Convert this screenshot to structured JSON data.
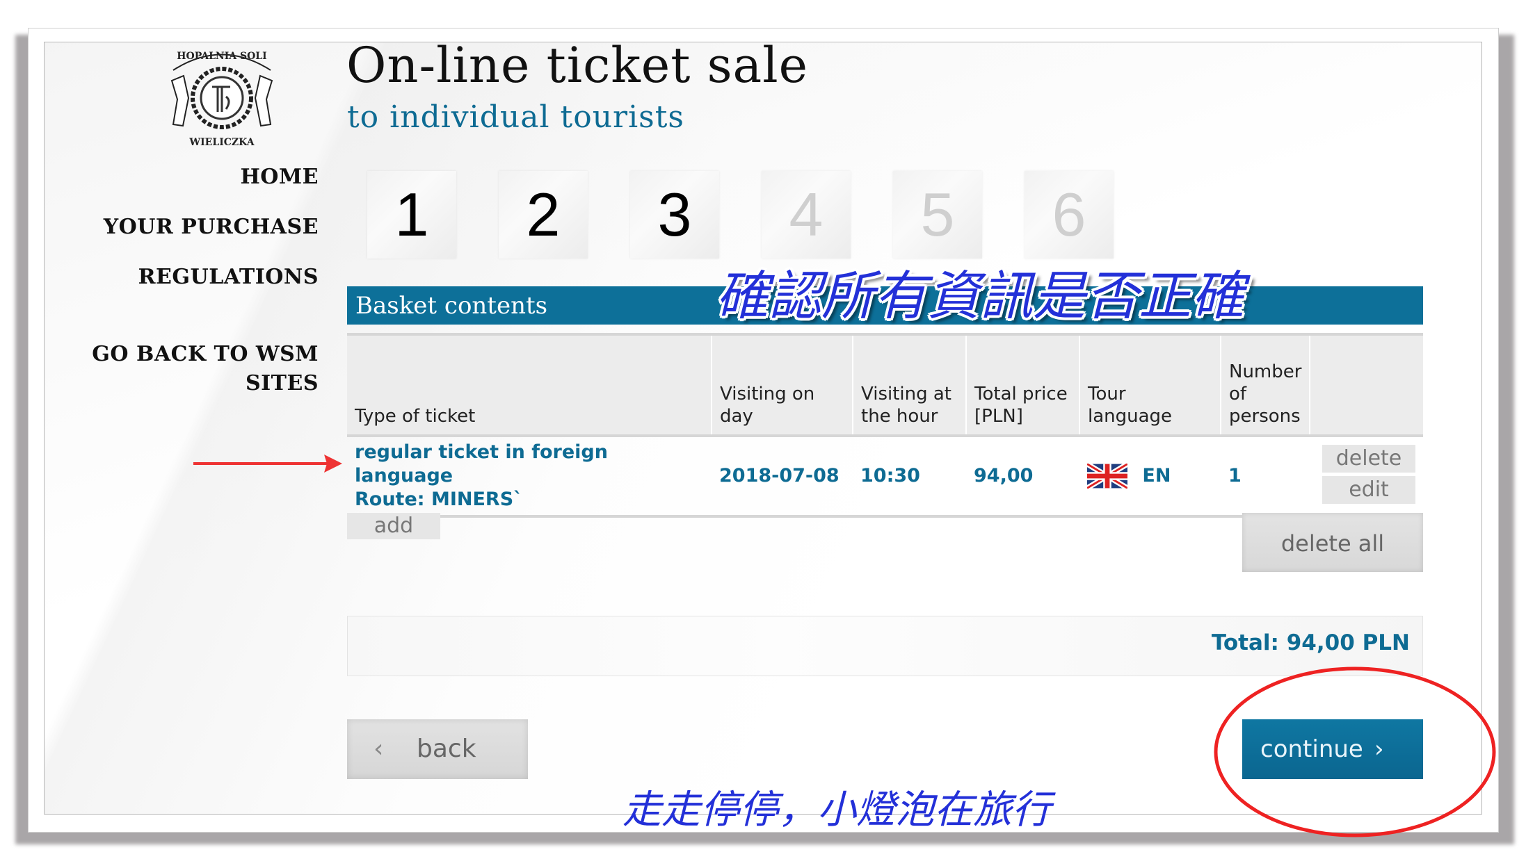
{
  "header": {
    "title": "On-line ticket sale",
    "subtitle": "to individual tourists",
    "logo": {
      "top_text": "HOPALNIA SOLI",
      "bottom_text": "WIELICZKA",
      "icon": "salt-mine-crest-logo"
    }
  },
  "nav": {
    "items": [
      {
        "label": "HOME"
      },
      {
        "label": "YOUR PURCHASE"
      },
      {
        "label": "REGULATIONS"
      },
      {
        "label": "GO BACK TO WSM SITES"
      }
    ]
  },
  "steps": {
    "current": 3,
    "items": [
      {
        "label": "1",
        "state": "done"
      },
      {
        "label": "2",
        "state": "done"
      },
      {
        "label": "3",
        "state": "active"
      },
      {
        "label": "4",
        "state": "inactive"
      },
      {
        "label": "5",
        "state": "inactive"
      },
      {
        "label": "6",
        "state": "inactive"
      }
    ]
  },
  "basket": {
    "title": "Basket contents",
    "columns": [
      "Type of ticket",
      "Visiting on day",
      "Visiting at the hour",
      "Total price [PLN]",
      "Tour language",
      "Number of persons",
      ""
    ],
    "rows": [
      {
        "ticket_type": "regular ticket in foreign language",
        "route": "Route: MINERS`",
        "date": "2018-07-08",
        "hour": "10:30",
        "price": "94,00",
        "language_flag": "uk-flag-icon",
        "language": "EN",
        "persons": "1",
        "delete_label": "delete",
        "edit_label": "edit"
      }
    ],
    "add_label": "add",
    "delete_all_label": "delete all",
    "total": "Total: 94,00 PLN"
  },
  "footer": {
    "back_label": "back",
    "continue_label": "continue"
  },
  "annotations": {
    "overlay_note": "確認所有資訊是否正確",
    "watermark": "走走停停，小燈泡在旅行",
    "arrow_color": "#ee3333",
    "circle_color": "#ee2222",
    "note_color": "#2330d8"
  },
  "colors": {
    "brand_teal": "#0d7099",
    "text_teal": "#0e6b93",
    "button_gray": "#e6e6e6"
  }
}
